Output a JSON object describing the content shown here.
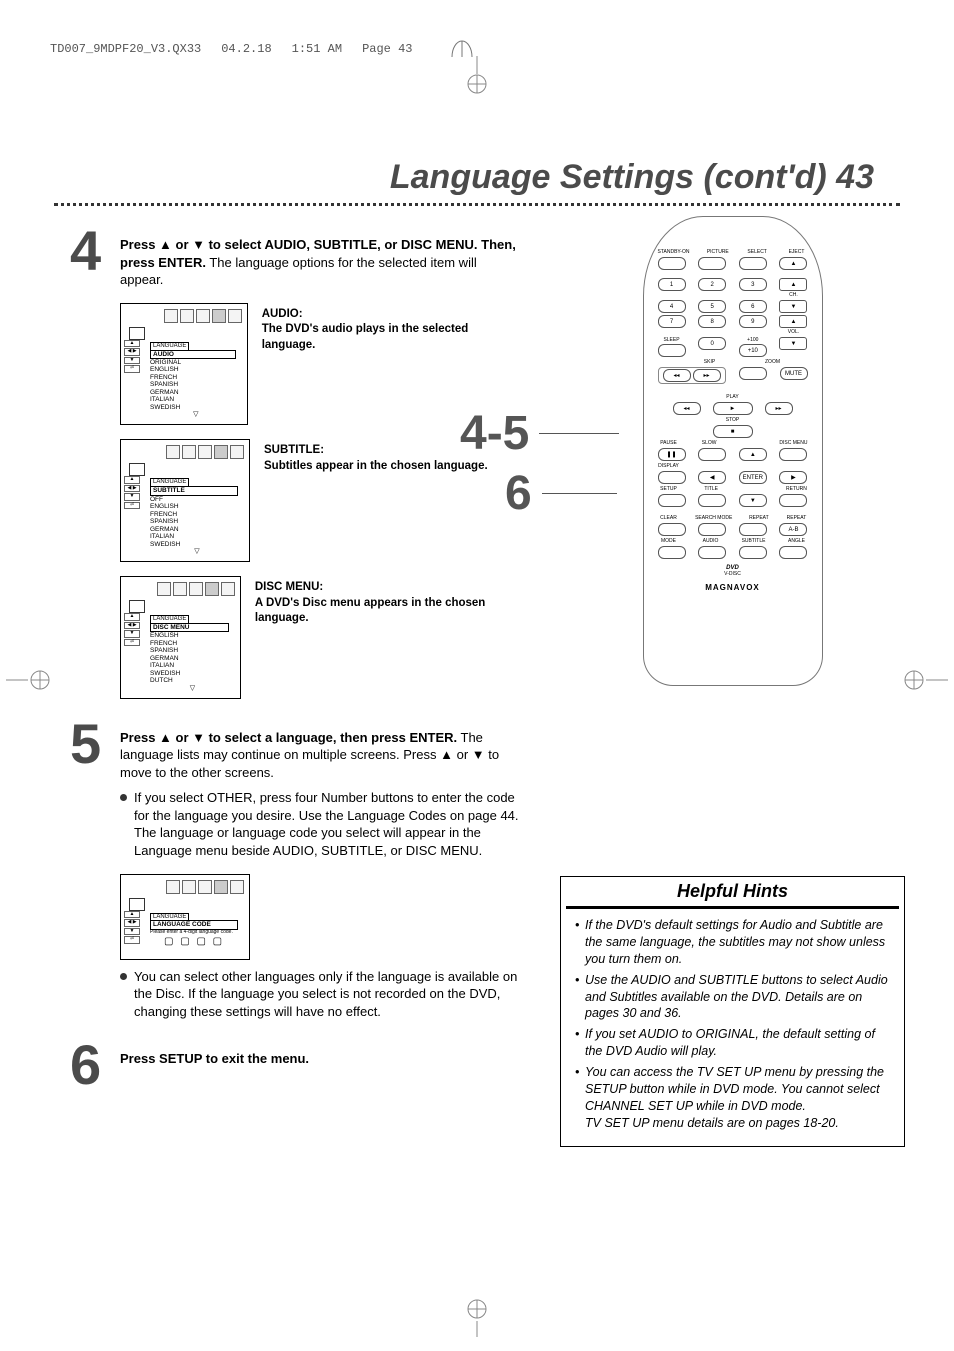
{
  "print_header": {
    "file": "TD007_9MDPF20_V3.QX33",
    "date": "04.2.18",
    "time": "1:51 AM",
    "pagelabel": "Page 43"
  },
  "title": "Language Settings (cont'd)  43",
  "step4": {
    "num": "4",
    "lead_bold": "Press ▲ or ▼ to select AUDIO, SUBTITLE, or DISC MENU.  Then, press ENTER.",
    "lead_rest": " The language options for the selected item will appear.",
    "audio": {
      "h": "AUDIO:",
      "t": "The DVD's audio plays in the selected language.",
      "sel": "AUDIO",
      "items": [
        "ORIGINAL",
        "ENGLISH",
        "FRENCH",
        "SPANISH",
        "GERMAN",
        "ITALIAN",
        "SWEDISH"
      ]
    },
    "subtitle": {
      "h": "SUBTITLE:",
      "t": "Subtitles appear in the chosen language.",
      "sel": "SUBTITLE",
      "items": [
        "OFF",
        "ENGLISH",
        "FRENCH",
        "SPANISH",
        "GERMAN",
        "ITALIAN",
        "SWEDISH"
      ]
    },
    "discmenu": {
      "h": "DISC MENU:",
      "t": "A DVD's Disc menu appears in the chosen language.",
      "sel": "DISC MENU",
      "items": [
        "ENGLISH",
        "FRENCH",
        "SPANISH",
        "GERMAN",
        "ITALIAN",
        "SWEDISH",
        "DUTCH"
      ]
    },
    "tab": "LANGUAGE"
  },
  "step5": {
    "num": "5",
    "lead_bold": "Press ▲ or ▼ to select a language, then press ENTER.",
    "lead_rest": "  The language lists may continue on multiple screens.  Press ▲ or ▼ to move to the other screens.",
    "b1": "If you select OTHER, press four Number buttons to enter the code for the language you desire.  Use the Language Codes on page 44.  The language or language code you select will appear in the Language menu beside AUDIO, SUBTITLE, or DISC MENU.",
    "diag_sel": "LANGUAGE CODE",
    "diag_hint": "Please enter a 4-digit language code.",
    "diag_boxes": "▢ ▢ ▢ ▢",
    "b2": "You can select other languages only if the language is available on the Disc.  If the language you select is not recorded on the DVD, changing these settings will have no effect."
  },
  "step6": {
    "num": "6",
    "text": "Press SETUP to exit the menu."
  },
  "callouts": {
    "c45": "4-5",
    "c6": "6"
  },
  "remote": {
    "r1": [
      "STANDBY-ON",
      "PICTURE",
      "SELECT",
      "EJECT"
    ],
    "r1b": [
      "",
      "",
      "",
      "▲"
    ],
    "numrows": [
      [
        "1",
        "2",
        "3"
      ],
      [
        "4",
        "5",
        "6"
      ],
      [
        "7",
        "8",
        "9"
      ]
    ],
    "ch": "CH.",
    "chbtns": [
      "▲",
      "▼"
    ],
    "sleep": "SLEEP",
    "plus100": "+100",
    "zero": "0",
    "plus10": "+10",
    "vol": "VOL.",
    "volbtns": [
      "▲",
      "▼"
    ],
    "skip": "SKIP",
    "zoom": "ZOOM",
    "skipl": "◂◂",
    "skipr": "▸▸",
    "mute": "MUTE",
    "play": "PLAY",
    "play_sym": "►",
    "revl": "◂◂",
    "revr": "▸▸",
    "stop": "STOP",
    "stop_sym": "■",
    "pause": "PAUSE",
    "pause_sym": "❚❚",
    "slow": "SLOW",
    "discmenu": "DISC MENU",
    "up": "▲",
    "display": "DISPLAY",
    "left": "◀",
    "enter": "ENTER",
    "right": "▶",
    "setup": "SETUP",
    "title": "TITLE",
    "return": "RETURN",
    "down": "▼",
    "rrow1": [
      "CLEAR",
      "SEARCH MODE",
      "REPEAT",
      "REPEAT"
    ],
    "rrow1b": [
      "",
      "",
      "",
      "A-B"
    ],
    "rrow2": [
      "MODE",
      "AUDIO",
      "SUBTITLE",
      "ANGLE"
    ],
    "dvd": "DVD",
    "vdisc": "V-DISC",
    "brand": "MAGNAVOX"
  },
  "hints": {
    "title": "Helpful Hints",
    "items": [
      "If the DVD's default settings for Audio and Subtitle are the same language, the subtitles may not show unless you turn them on.",
      "Use the AUDIO and SUBTITLE buttons to select Audio and Subtitles available on the DVD. Details are on pages 30 and 36.",
      "If you set AUDIO to ORIGINAL, the default setting of the DVD Audio will play.",
      "You can access the TV SET UP menu by pressing the SETUP button while in DVD mode. You cannot select CHANNEL SET UP while in DVD mode."
    ],
    "note": "TV SET UP menu details are on pages 18-20."
  }
}
